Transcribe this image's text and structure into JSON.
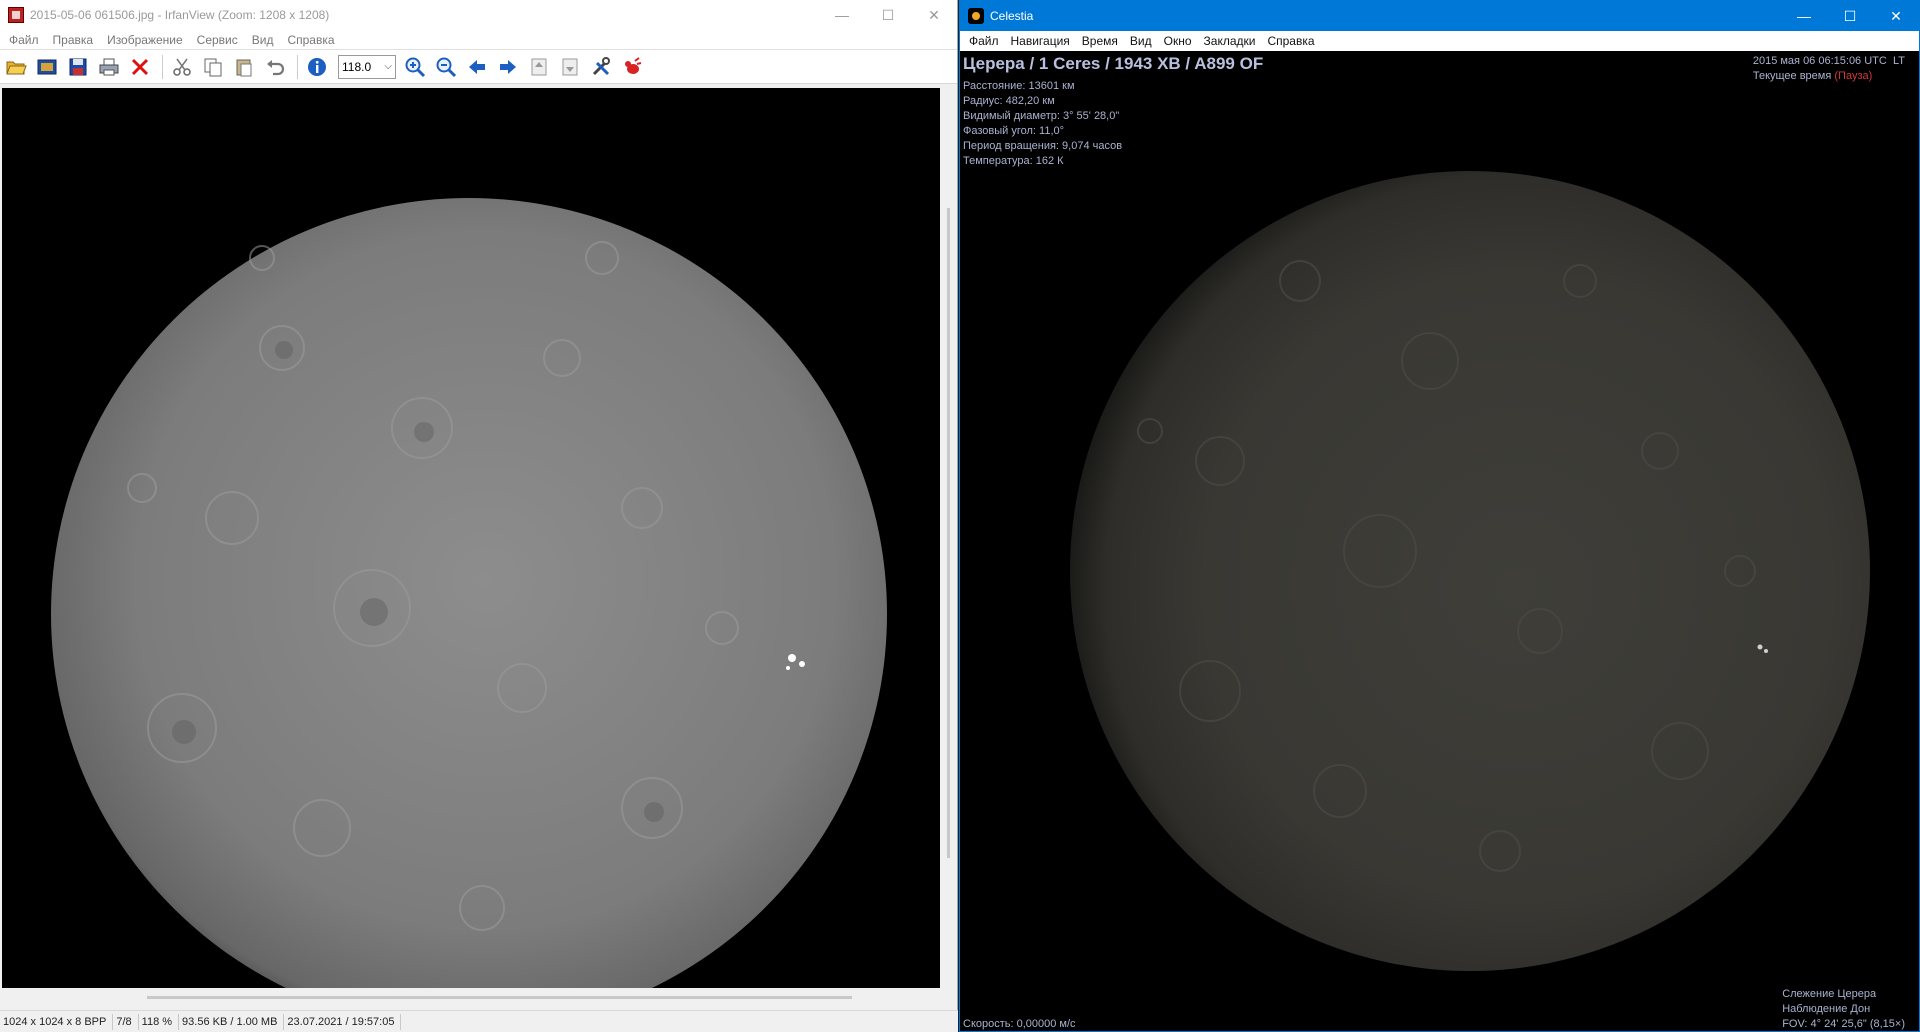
{
  "irfanview": {
    "window_title": "2015-05-06 061506.jpg - IrfanView (Zoom: 1208 x 1208)",
    "menu": [
      "Файл",
      "Правка",
      "Изображение",
      "Сервис",
      "Вид",
      "Справка"
    ],
    "toolbar": {
      "icons": [
        "open-folder-icon",
        "slideshow-icon",
        "save-icon",
        "print-icon",
        "delete-icon",
        "cut-icon",
        "copy-icon",
        "paste-icon",
        "undo-icon",
        "info-icon",
        "zoom-in-icon",
        "zoom-out-icon",
        "previous-icon",
        "next-icon",
        "first-page-icon",
        "last-page-icon",
        "settings-icon",
        "irfanview-logo-icon"
      ],
      "zoom_value": "118.0"
    },
    "status": {
      "dimensions": "1024 x 1024 x 8 BPP",
      "index": "7/8",
      "zoom": "118 %",
      "size": "93.56 KB / 1.00 MB",
      "datetime": "23.07.2021 / 19:57:05"
    }
  },
  "celestia": {
    "window_title": "Celestia",
    "menu": [
      "Файл",
      "Навигация",
      "Время",
      "Вид",
      "Окно",
      "Закладки",
      "Справка"
    ],
    "object_name": "Церера / 1 Ceres / 1943 XB / A899 OF",
    "info": {
      "distance": "Расстояние: 13601 км",
      "radius": "Радиус: 482,20 км",
      "apparent_diameter": "Видимый диаметр: 3° 55' 28,0\"",
      "phase_angle": "Фазовый угол: 11,0°",
      "rotation_period": "Период вращения: 9,074 часов",
      "temperature": "Температура: 162 К"
    },
    "time": {
      "datetime": "2015 мая 06 06:15:06 UTC",
      "lt": "LT",
      "current_time_label": "Текущее время",
      "paused": "(Пауза)"
    },
    "speed": "Скорость: 0,00000 м/с",
    "tracking": {
      "track": "Слежение Церера",
      "observer": "Наблюдение Дон",
      "fov": "FOV: 4° 24' 25,6\" (8,15×)"
    }
  },
  "colors": {
    "celestia_title_bg": "#0078d7",
    "hud_text": "#aab2cf",
    "pause_red": "#d23a3a"
  }
}
